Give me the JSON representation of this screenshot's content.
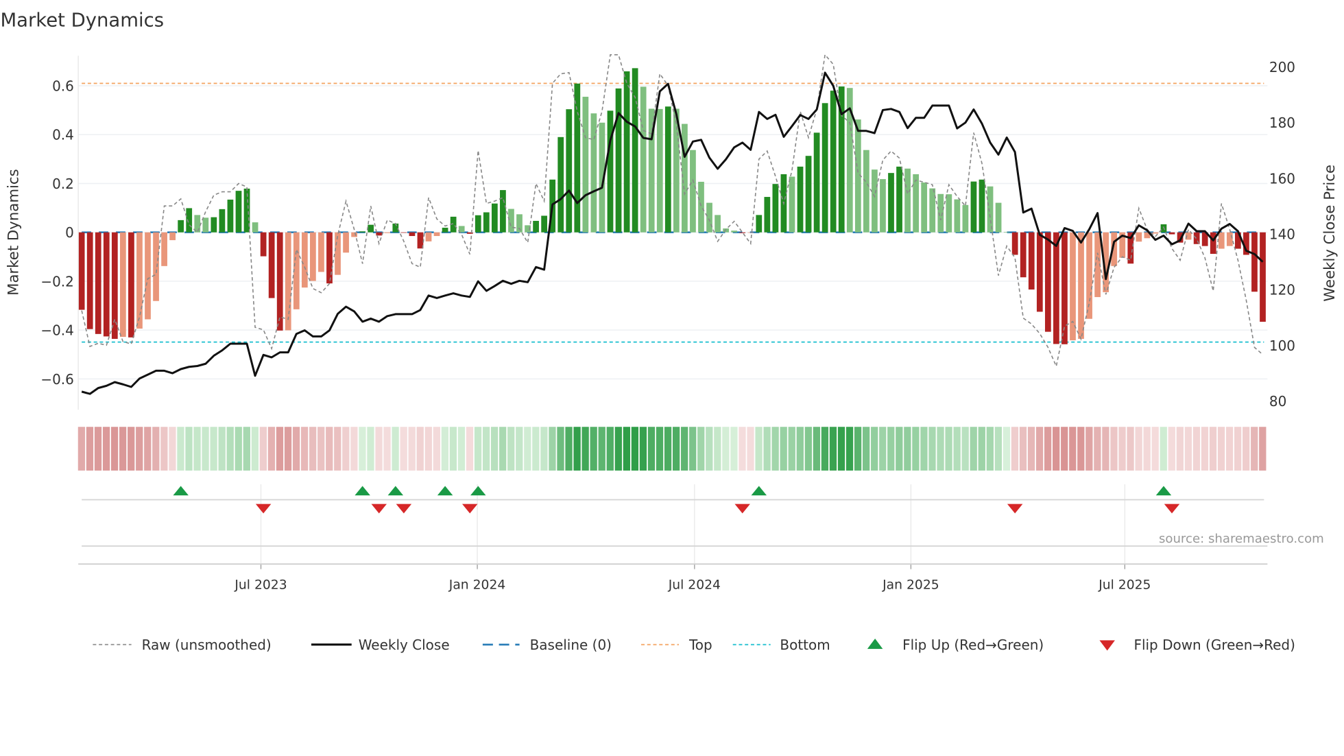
{
  "chart_data": {
    "type": "bar",
    "title": "Market Dynamics",
    "ylabel": "Market Dynamics",
    "y2label": "Weekly Close Price",
    "ylim": [
      -0.726,
      0.723
    ],
    "y2lim": [
      76.9,
      204
    ],
    "grid": true,
    "legend_position": "bottom",
    "x_ticks": [
      {
        "label": "Jul 2023",
        "week": 21.7
      },
      {
        "label": "Jan 2024",
        "week": 47.9
      },
      {
        "label": "Jul 2024",
        "week": 74.2
      },
      {
        "label": "Jan 2025",
        "week": 100.4
      },
      {
        "label": "Jul 2025",
        "week": 126.3
      }
    ],
    "y_ticks": [
      "0.6",
      "0.4",
      "0.2",
      "0",
      "−0.2",
      "−0.4",
      "−0.6"
    ],
    "y_tick_values": [
      0.6,
      0.4,
      0.2,
      0,
      -0.2,
      -0.4,
      -0.6
    ],
    "y2_ticks": [
      "200",
      "180",
      "160",
      "140",
      "120",
      "100",
      "80"
    ],
    "y2_tick_values": [
      200,
      180,
      160,
      140,
      120,
      100,
      80
    ],
    "top_level": 0.61,
    "bottom_level": -0.449,
    "baseline": 0,
    "smoothed": [
      -0.317,
      -0.396,
      -0.416,
      -0.426,
      -0.436,
      -0.428,
      -0.43,
      -0.394,
      -0.356,
      -0.281,
      -0.138,
      -0.032,
      0.05,
      0.099,
      0.071,
      0.06,
      0.062,
      0.095,
      0.134,
      0.17,
      0.179,
      0.041,
      -0.098,
      -0.269,
      -0.402,
      -0.401,
      -0.315,
      -0.226,
      -0.199,
      -0.162,
      -0.209,
      -0.174,
      -0.083,
      -0.019,
      0.004,
      0.031,
      -0.013,
      -0.003,
      0.036,
      -0.002,
      -0.015,
      -0.066,
      -0.037,
      -0.015,
      0.019,
      0.064,
      0.026,
      -0.006,
      0.07,
      0.082,
      0.118,
      0.173,
      0.096,
      0.074,
      0.029,
      0.047,
      0.068,
      0.216,
      0.39,
      0.504,
      0.609,
      0.555,
      0.487,
      0.449,
      0.498,
      0.589,
      0.659,
      0.672,
      0.596,
      0.506,
      0.505,
      0.515,
      0.506,
      0.444,
      0.337,
      0.207,
      0.121,
      0.071,
      0.016,
      0.007,
      -0.003,
      -0.002,
      0.071,
      0.145,
      0.198,
      0.238,
      0.228,
      0.269,
      0.313,
      0.408,
      0.529,
      0.58,
      0.597,
      0.591,
      0.462,
      0.337,
      0.257,
      0.218,
      0.243,
      0.269,
      0.261,
      0.238,
      0.204,
      0.18,
      0.157,
      0.156,
      0.135,
      0.112,
      0.208,
      0.216,
      0.188,
      0.121,
      0.002,
      -0.092,
      -0.184,
      -0.234,
      -0.325,
      -0.407,
      -0.457,
      -0.458,
      -0.442,
      -0.436,
      -0.354,
      -0.265,
      -0.245,
      -0.138,
      -0.104,
      -0.128,
      -0.038,
      -0.024,
      -0.005,
      0.033,
      -0.008,
      -0.042,
      -0.03,
      -0.048,
      -0.056,
      -0.088,
      -0.067,
      -0.056,
      -0.067,
      -0.092,
      -0.243,
      -0.366
    ],
    "raw": [
      -0.32,
      -0.467,
      -0.454,
      -0.462,
      -0.356,
      -0.447,
      -0.457,
      -0.346,
      -0.19,
      -0.172,
      0.108,
      0.108,
      0.137,
      0.031,
      0,
      0.084,
      0.152,
      0.166,
      0.166,
      0.2,
      0.186,
      -0.389,
      -0.399,
      -0.476,
      -0.346,
      -0.356,
      -0.07,
      -0.143,
      -0.23,
      -0.247,
      -0.21,
      -0.013,
      0.128,
      0.012,
      -0.128,
      0.108,
      -0.046,
      0.05,
      0.036,
      -0.037,
      -0.128,
      -0.143,
      0.142,
      0.055,
      0.026,
      0.036,
      -0.008,
      -0.09,
      0.335,
      0.118,
      0.128,
      0.142,
      0.021,
      0.016,
      -0.042,
      0.2,
      0.128,
      0.61,
      0.649,
      0.654,
      0.495,
      0.388,
      0.379,
      0.495,
      0.727,
      0.727,
      0.61,
      0.553,
      0.417,
      0.403,
      0.649,
      0.601,
      0.44,
      0.157,
      0.214,
      0.108,
      0.05,
      -0.037,
      0.012,
      0.045,
      0,
      -0.046,
      0.3,
      0.333,
      0.229,
      0.118,
      0.253,
      0.495,
      0.388,
      0.504,
      0.727,
      0.688,
      0.478,
      0.449,
      0.243,
      0.205,
      0.147,
      0.296,
      0.333,
      0.304,
      0.157,
      0.214,
      0.205,
      0.195,
      0.05,
      0.195,
      0.147,
      0.108,
      0.408,
      0.282,
      0.06,
      -0.177,
      -0.056,
      -0.104,
      -0.351,
      -0.375,
      -0.414,
      -0.471,
      -0.548,
      -0.384,
      -0.365,
      -0.437,
      -0.288,
      -0.084,
      -0.254,
      -0.143,
      -0.1,
      -0.114,
      0.098,
      0.012,
      -0.017,
      0.021,
      -0.066,
      -0.114,
      0.012,
      -0.027,
      -0.104,
      -0.24,
      0.118,
      0.012,
      -0.114,
      -0.277,
      -0.471,
      -0.5
    ],
    "close": [
      83.4,
      82.6,
      84.7,
      85.5,
      86.8,
      86,
      85.1,
      88.1,
      89.5,
      90.9,
      90.9,
      90,
      91.5,
      92.3,
      92.6,
      93.4,
      96.3,
      98.2,
      100.6,
      100.6,
      100.6,
      89.1,
      96.6,
      95.7,
      97.5,
      97.5,
      104.1,
      105.4,
      103.2,
      103.2,
      105.4,
      111.3,
      113.9,
      112.2,
      108.5,
      109.6,
      108.5,
      110.5,
      111.2,
      111.2,
      111.2,
      112.7,
      117.9,
      117,
      117.9,
      118.7,
      117.9,
      117.4,
      123,
      119.6,
      121.3,
      123.2,
      122.1,
      123.2,
      122.7,
      128.1,
      127.2,
      150.6,
      152.5,
      155.6,
      151.1,
      153.9,
      155.3,
      156.6,
      173.6,
      183.4,
      180.3,
      178.6,
      174.5,
      174,
      191.2,
      193.9,
      183,
      167.7,
      173.2,
      173.8,
      167.4,
      163.4,
      166.8,
      171.1,
      172.8,
      170.2,
      183.8,
      181.3,
      182.8,
      174.9,
      178.7,
      182.7,
      181.3,
      184.7,
      197.9,
      193.2,
      183,
      185.1,
      177,
      177,
      176.2,
      184.5,
      184.9,
      183.8,
      178,
      181.7,
      181.7,
      186.1,
      186.1,
      186.1,
      177.9,
      180,
      184.7,
      179.6,
      172.8,
      168.5,
      174.6,
      169.4,
      147.7,
      149.1,
      139.7,
      138,
      135.7,
      142.1,
      141.1,
      136.9,
      141.7,
      147.5,
      123.8,
      137.2,
      139.4,
      138.5,
      143.1,
      141.3,
      137.9,
      139.4,
      136.3,
      137.7,
      143.7,
      141,
      141,
      137.7,
      141.9,
      143.6,
      141,
      134,
      132.8,
      130
    ],
    "flips_up": [
      12,
      34,
      38,
      44,
      48,
      82,
      131
    ],
    "flips_down": [
      22,
      36,
      39,
      47,
      80,
      113,
      132
    ],
    "source": "source: sharemaestro.com",
    "legend": [
      {
        "label": "Raw (unsmoothed)",
        "kind": "raw"
      },
      {
        "label": "Weekly Close",
        "kind": "close"
      },
      {
        "label": "Baseline (0)",
        "kind": "baseline"
      },
      {
        "label": "Top",
        "kind": "top"
      },
      {
        "label": "Bottom",
        "kind": "bottom"
      },
      {
        "label": "Flip Up (Red→Green)",
        "kind": "up"
      },
      {
        "label": "Flip Down (Green→Red)",
        "kind": "down"
      }
    ],
    "colors": {
      "pos_strong": "#228b22",
      "pos_weak": "#7fbf7f",
      "neg_strong": "#b22222",
      "neg_weak": "#e9967a",
      "close": "#111111",
      "raw": "#888888",
      "baseline": "#1f77b4",
      "top": "#f4a460",
      "bottom": "#17becf",
      "flip_up": "#1a9a46",
      "flip_down": "#d62728"
    }
  }
}
